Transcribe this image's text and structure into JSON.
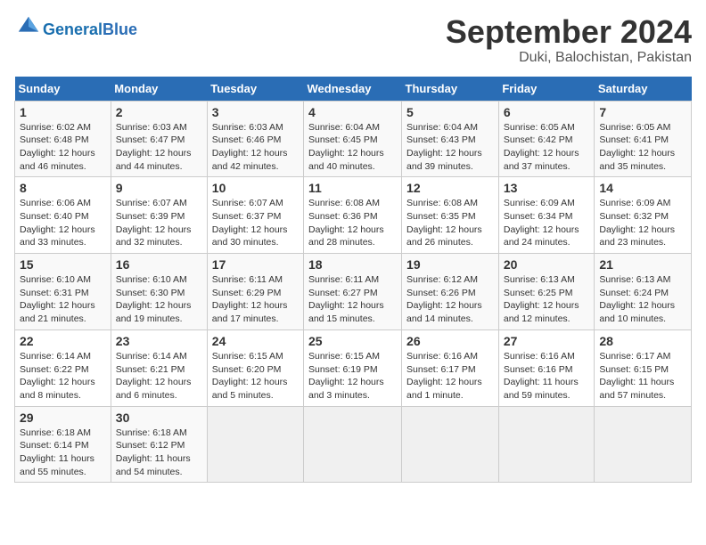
{
  "logo": {
    "text_general": "General",
    "text_blue": "Blue"
  },
  "title": "September 2024",
  "subtitle": "Duki, Balochistan, Pakistan",
  "headers": [
    "Sunday",
    "Monday",
    "Tuesday",
    "Wednesday",
    "Thursday",
    "Friday",
    "Saturday"
  ],
  "weeks": [
    [
      {
        "day": "1",
        "sunrise": "Sunrise: 6:02 AM",
        "sunset": "Sunset: 6:48 PM",
        "daylight": "Daylight: 12 hours and 46 minutes."
      },
      {
        "day": "2",
        "sunrise": "Sunrise: 6:03 AM",
        "sunset": "Sunset: 6:47 PM",
        "daylight": "Daylight: 12 hours and 44 minutes."
      },
      {
        "day": "3",
        "sunrise": "Sunrise: 6:03 AM",
        "sunset": "Sunset: 6:46 PM",
        "daylight": "Daylight: 12 hours and 42 minutes."
      },
      {
        "day": "4",
        "sunrise": "Sunrise: 6:04 AM",
        "sunset": "Sunset: 6:45 PM",
        "daylight": "Daylight: 12 hours and 40 minutes."
      },
      {
        "day": "5",
        "sunrise": "Sunrise: 6:04 AM",
        "sunset": "Sunset: 6:43 PM",
        "daylight": "Daylight: 12 hours and 39 minutes."
      },
      {
        "day": "6",
        "sunrise": "Sunrise: 6:05 AM",
        "sunset": "Sunset: 6:42 PM",
        "daylight": "Daylight: 12 hours and 37 minutes."
      },
      {
        "day": "7",
        "sunrise": "Sunrise: 6:05 AM",
        "sunset": "Sunset: 6:41 PM",
        "daylight": "Daylight: 12 hours and 35 minutes."
      }
    ],
    [
      {
        "day": "8",
        "sunrise": "Sunrise: 6:06 AM",
        "sunset": "Sunset: 6:40 PM",
        "daylight": "Daylight: 12 hours and 33 minutes."
      },
      {
        "day": "9",
        "sunrise": "Sunrise: 6:07 AM",
        "sunset": "Sunset: 6:39 PM",
        "daylight": "Daylight: 12 hours and 32 minutes."
      },
      {
        "day": "10",
        "sunrise": "Sunrise: 6:07 AM",
        "sunset": "Sunset: 6:37 PM",
        "daylight": "Daylight: 12 hours and 30 minutes."
      },
      {
        "day": "11",
        "sunrise": "Sunrise: 6:08 AM",
        "sunset": "Sunset: 6:36 PM",
        "daylight": "Daylight: 12 hours and 28 minutes."
      },
      {
        "day": "12",
        "sunrise": "Sunrise: 6:08 AM",
        "sunset": "Sunset: 6:35 PM",
        "daylight": "Daylight: 12 hours and 26 minutes."
      },
      {
        "day": "13",
        "sunrise": "Sunrise: 6:09 AM",
        "sunset": "Sunset: 6:34 PM",
        "daylight": "Daylight: 12 hours and 24 minutes."
      },
      {
        "day": "14",
        "sunrise": "Sunrise: 6:09 AM",
        "sunset": "Sunset: 6:32 PM",
        "daylight": "Daylight: 12 hours and 23 minutes."
      }
    ],
    [
      {
        "day": "15",
        "sunrise": "Sunrise: 6:10 AM",
        "sunset": "Sunset: 6:31 PM",
        "daylight": "Daylight: 12 hours and 21 minutes."
      },
      {
        "day": "16",
        "sunrise": "Sunrise: 6:10 AM",
        "sunset": "Sunset: 6:30 PM",
        "daylight": "Daylight: 12 hours and 19 minutes."
      },
      {
        "day": "17",
        "sunrise": "Sunrise: 6:11 AM",
        "sunset": "Sunset: 6:29 PM",
        "daylight": "Daylight: 12 hours and 17 minutes."
      },
      {
        "day": "18",
        "sunrise": "Sunrise: 6:11 AM",
        "sunset": "Sunset: 6:27 PM",
        "daylight": "Daylight: 12 hours and 15 minutes."
      },
      {
        "day": "19",
        "sunrise": "Sunrise: 6:12 AM",
        "sunset": "Sunset: 6:26 PM",
        "daylight": "Daylight: 12 hours and 14 minutes."
      },
      {
        "day": "20",
        "sunrise": "Sunrise: 6:13 AM",
        "sunset": "Sunset: 6:25 PM",
        "daylight": "Daylight: 12 hours and 12 minutes."
      },
      {
        "day": "21",
        "sunrise": "Sunrise: 6:13 AM",
        "sunset": "Sunset: 6:24 PM",
        "daylight": "Daylight: 12 hours and 10 minutes."
      }
    ],
    [
      {
        "day": "22",
        "sunrise": "Sunrise: 6:14 AM",
        "sunset": "Sunset: 6:22 PM",
        "daylight": "Daylight: 12 hours and 8 minutes."
      },
      {
        "day": "23",
        "sunrise": "Sunrise: 6:14 AM",
        "sunset": "Sunset: 6:21 PM",
        "daylight": "Daylight: 12 hours and 6 minutes."
      },
      {
        "day": "24",
        "sunrise": "Sunrise: 6:15 AM",
        "sunset": "Sunset: 6:20 PM",
        "daylight": "Daylight: 12 hours and 5 minutes."
      },
      {
        "day": "25",
        "sunrise": "Sunrise: 6:15 AM",
        "sunset": "Sunset: 6:19 PM",
        "daylight": "Daylight: 12 hours and 3 minutes."
      },
      {
        "day": "26",
        "sunrise": "Sunrise: 6:16 AM",
        "sunset": "Sunset: 6:17 PM",
        "daylight": "Daylight: 12 hours and 1 minute."
      },
      {
        "day": "27",
        "sunrise": "Sunrise: 6:16 AM",
        "sunset": "Sunset: 6:16 PM",
        "daylight": "Daylight: 11 hours and 59 minutes."
      },
      {
        "day": "28",
        "sunrise": "Sunrise: 6:17 AM",
        "sunset": "Sunset: 6:15 PM",
        "daylight": "Daylight: 11 hours and 57 minutes."
      }
    ],
    [
      {
        "day": "29",
        "sunrise": "Sunrise: 6:18 AM",
        "sunset": "Sunset: 6:14 PM",
        "daylight": "Daylight: 11 hours and 55 minutes."
      },
      {
        "day": "30",
        "sunrise": "Sunrise: 6:18 AM",
        "sunset": "Sunset: 6:12 PM",
        "daylight": "Daylight: 11 hours and 54 minutes."
      },
      null,
      null,
      null,
      null,
      null
    ]
  ]
}
